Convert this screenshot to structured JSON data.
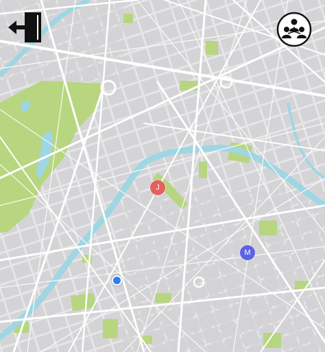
{
  "map": {
    "colors": {
      "land": "#e6e6e8",
      "block": "#d4d4d6",
      "road": "#ffffff",
      "park": "#b7d67f",
      "park_dark": "#a9cd6d",
      "water": "#9fd6e3"
    }
  },
  "controls": {
    "exit_icon": "exit-door-icon",
    "group_icon": "group-people-icon"
  },
  "markers": [
    {
      "label": "J",
      "color": "#e3605f"
    },
    {
      "label": "M",
      "color": "#5d63e6"
    }
  ],
  "current_location": {
    "color": "#2d7ef0"
  }
}
